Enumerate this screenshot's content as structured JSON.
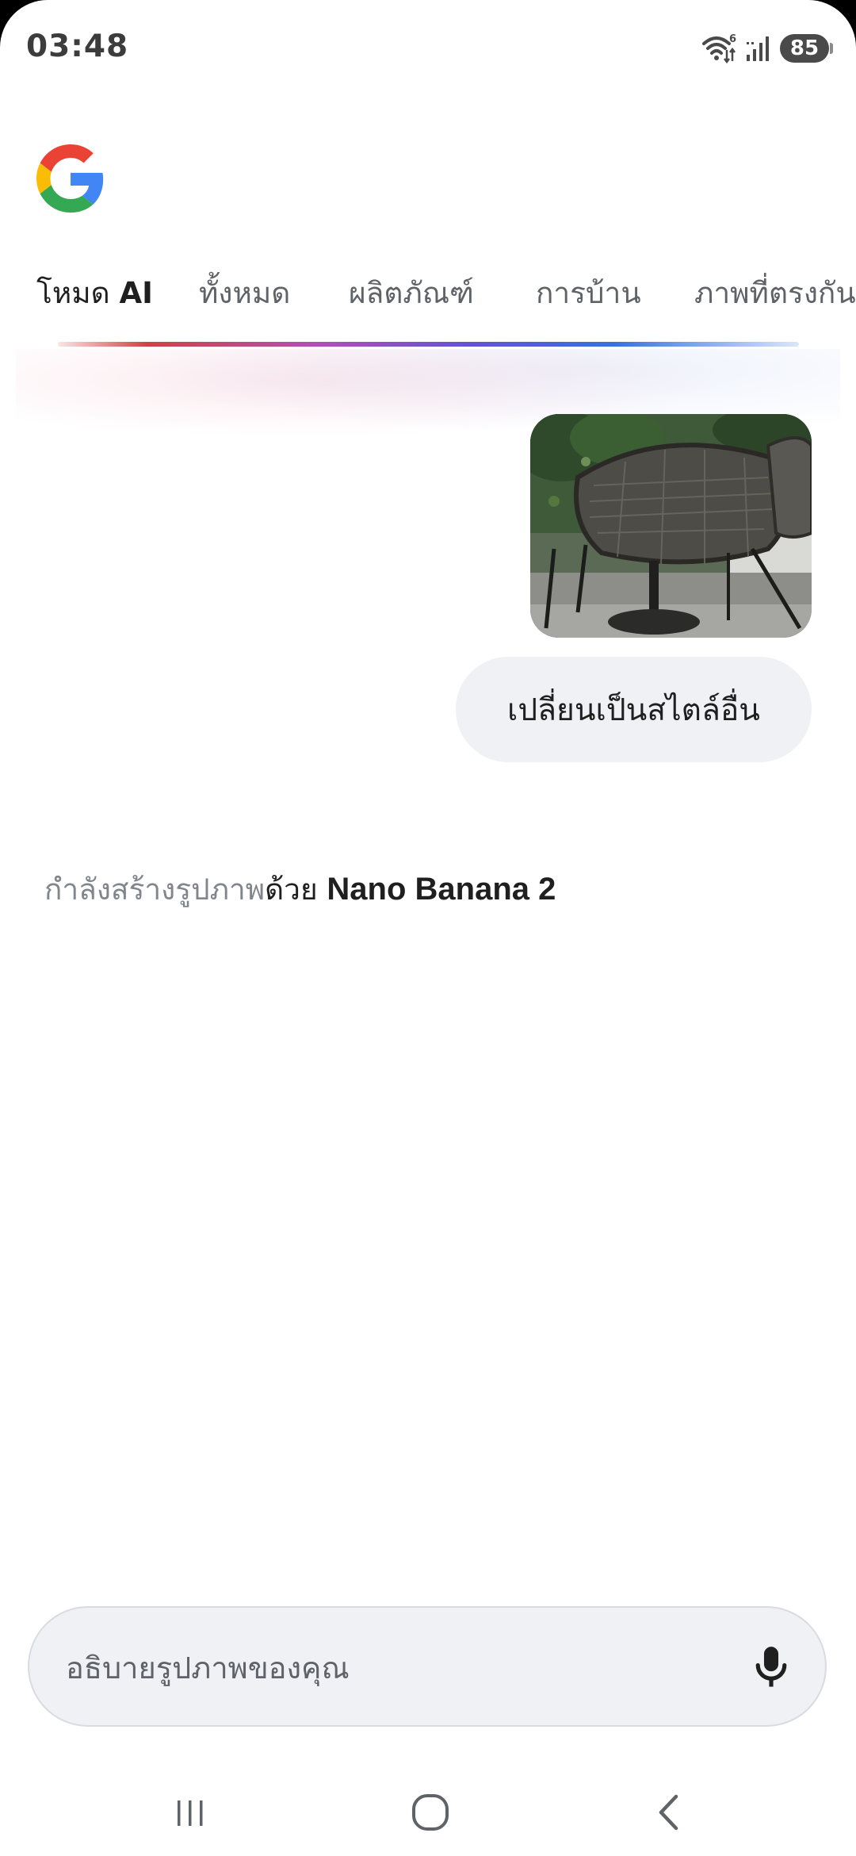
{
  "status_bar": {
    "time": "03:48",
    "wifi_badge": "6",
    "battery": "85"
  },
  "tabs": [
    {
      "label_thai": "โหมด ",
      "label_latin": "AI",
      "active": true
    },
    {
      "label": "ทั้งหมด",
      "active": false
    },
    {
      "label": "ผลิตภัณฑ์",
      "active": false
    },
    {
      "label": "การบ้าน",
      "active": false
    },
    {
      "label": "ภาพที่ตรงกัน",
      "active": false
    }
  ],
  "conversation": {
    "user_image_icon": "patio-wicker-chair-photo",
    "user_message": "เปลี่ยนเป็นสไตล์อื่น",
    "status_prefix": "กำลังสร้างรูปภาพ",
    "status_middle": "ด้วย ",
    "status_model": "Nano Banana 2"
  },
  "input": {
    "placeholder": "อธิบายรูปภาพของคุณ",
    "value": ""
  },
  "icons": {
    "logo": "google-g-icon",
    "mic": "microphone-icon",
    "nav_recents": "recent-apps-icon",
    "nav_home": "home-icon",
    "nav_back": "back-icon"
  },
  "colors": {
    "bubble_bg": "#eff1f5",
    "text_primary": "#1f1f1f",
    "text_muted": "#80868b",
    "g_blue": "#4285f4",
    "g_red": "#ea4335",
    "g_yellow": "#fbbc05",
    "g_green": "#34a853"
  }
}
